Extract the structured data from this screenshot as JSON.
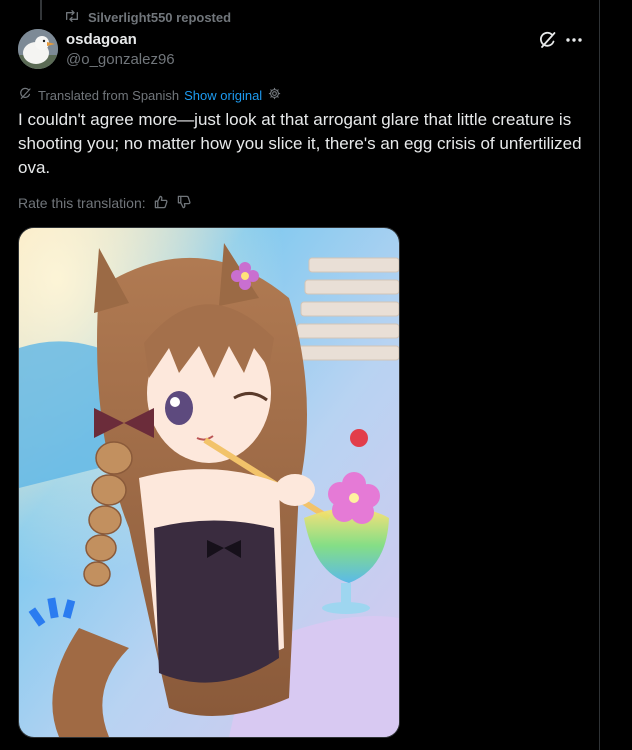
{
  "repost": {
    "text": "Silverlight550 reposted",
    "icon": "repost-icon"
  },
  "author": {
    "display_name": "osdagoan",
    "handle": "@o_gonzalez96",
    "avatar_icon": "goose-avatar"
  },
  "actions": {
    "grok_icon": "grok-icon",
    "more_icon": "more-icon"
  },
  "translation": {
    "prefix": "Translated from Spanish",
    "show_original": "Show original",
    "translate_icon": "translate-icon",
    "settings_icon": "gear-icon"
  },
  "post": {
    "text": "I couldn't agree more—just look at that arrogant glare that little creature is shooting you; no matter how you slice it, there's an egg crisis of unfertilized ova."
  },
  "rating": {
    "label": "Rate this translation:",
    "up_icon": "thumbs-up-icon",
    "down_icon": "thumbs-down-icon"
  },
  "media": {
    "kind": "image",
    "subject": "anime illustration"
  },
  "colors": {
    "background": "#000000",
    "text": "#e7e9ea",
    "muted": "#71767b",
    "link": "#1d9bf0",
    "border": "#2f3336"
  }
}
